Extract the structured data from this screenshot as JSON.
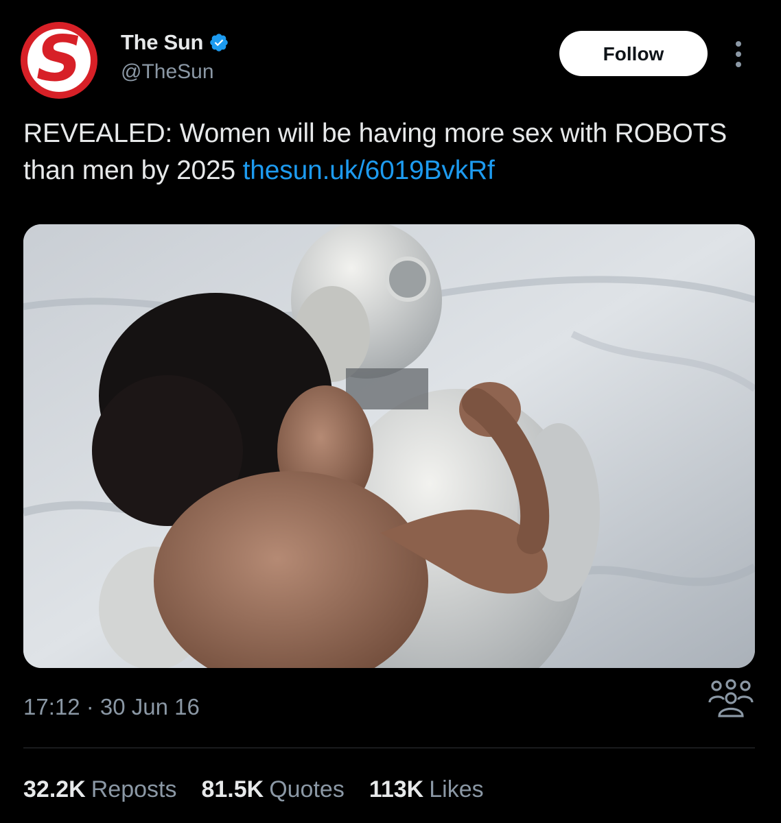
{
  "account": {
    "display_name": "The Sun",
    "handle": "@TheSun",
    "avatar_letter": "S",
    "verified": true
  },
  "header": {
    "follow_label": "Follow"
  },
  "tweet": {
    "text": "REVEALED: Women will be having more sex with ROBOTS than men by 2025 ",
    "link": "thesun.uk/6019BvkRf"
  },
  "meta": {
    "timestamp": "17:12 · 30 Jun 16"
  },
  "stats": {
    "reposts_count": "32.2K",
    "reposts_label": "Reposts",
    "quotes_count": "81.5K",
    "quotes_label": "Quotes",
    "likes_count": "113K",
    "likes_label": "Likes"
  },
  "colors": {
    "background": "#000000",
    "text_primary": "#e7e9ea",
    "text_secondary": "#8b98a5",
    "link": "#1d9bf0",
    "verified": "#1d9bf0",
    "brand_red": "#d72027"
  },
  "icons": {
    "verified": "verified-badge-icon",
    "more": "more-vertical-icon",
    "community": "community-icon"
  }
}
